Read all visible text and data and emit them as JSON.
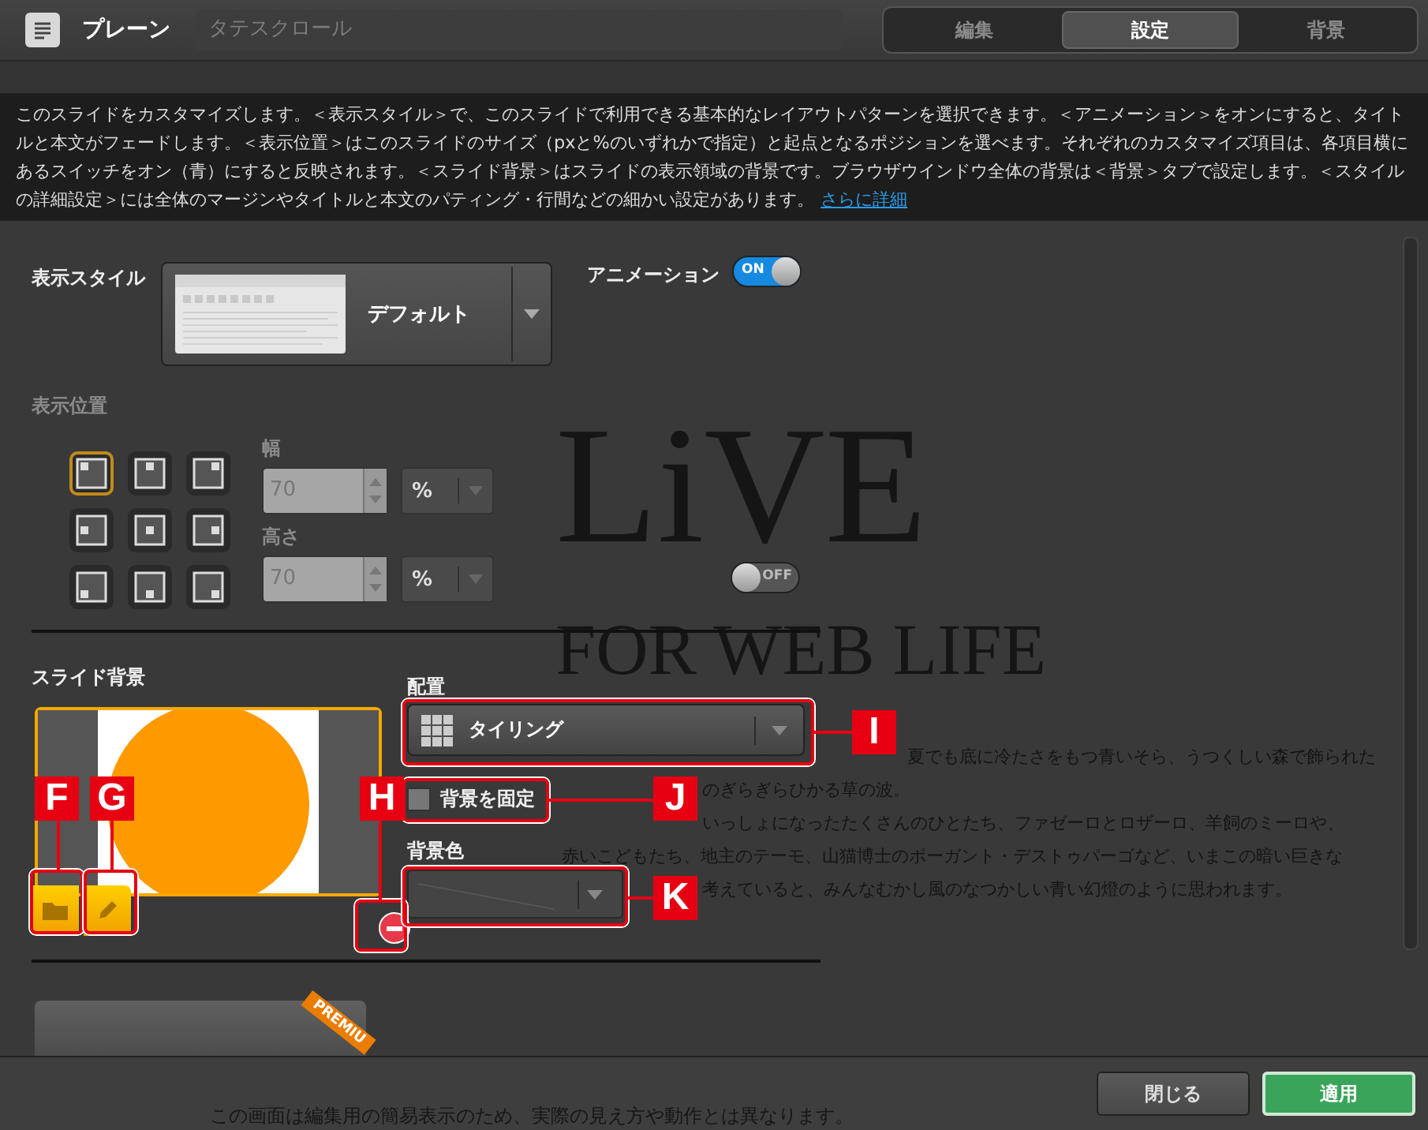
{
  "header": {
    "title": "プレーン",
    "scroll_field": "タテスクロール",
    "tabs": [
      {
        "label": "編集",
        "selected": false
      },
      {
        "label": "設定",
        "selected": true
      },
      {
        "label": "背景",
        "selected": false
      }
    ]
  },
  "description": {
    "text": "このスライドをカスタマイズします。＜表示スタイル＞で、このスライドで利用できる基本的なレイアウトパターンを選択できます。＜アニメーション＞をオンにすると、タイトルと本文がフェードします。＜表示位置＞はこのスライドのサイズ（pxと%のいずれかで指定）と起点となるポジションを選べます。それぞれのカスタマイズ項目は、各項目横にあるスイッチをオン（青）にすると反映されます。＜スライド背景＞はスライドの表示領域の背景です。ブラウザウインドウ全体の背景は＜背景＞タブで設定します。＜スタイルの詳細設定＞には全体のマージンやタイトルと本文のパティング・行間などの細かい設定があります。",
    "link": "さらに詳細"
  },
  "preview": {
    "logo": "LiVE",
    "tagline": "FOR WEB LIFE",
    "lines": [
      "夏でも底に冷たさをもつ青いそら、うつくしい森で飾られた",
      "のぎらぎらひかる草の波。",
      "いっしょになったたくさんのひとたち、ファゼーロとロザーロ、羊飼のミーロや、",
      "赤いこどもたち、地主のテーモ、山猫博士のボーガント・デストゥパーゴなど、いまこの暗い巨きな",
      "考えていると、みんなむかし風のなつかしい青い幻燈のように思われます。"
    ]
  },
  "display_style": {
    "label": "表示スタイル",
    "value": "デフォルト"
  },
  "animation": {
    "label": "アニメーション",
    "on": true,
    "toggle_text": "ON"
  },
  "position": {
    "label": "表示位置",
    "on": false,
    "toggle_text": "OFF",
    "cells": [
      {
        "selected": true
      },
      {
        "selected": false
      },
      {
        "selected": false
      },
      {
        "selected": false
      },
      {
        "selected": false
      },
      {
        "selected": false
      },
      {
        "selected": false
      },
      {
        "selected": false
      },
      {
        "selected": false
      }
    ],
    "width": {
      "label": "幅",
      "value": "70",
      "unit": "%"
    },
    "height": {
      "label": "高さ",
      "value": "70",
      "unit": "%"
    }
  },
  "slide_background": {
    "label": "スライド背景",
    "layout_label": "配置",
    "layout": "タイリング",
    "fixed": {
      "label": "背景を固定",
      "checked": false
    },
    "color_label": "背景色"
  },
  "premium_badge": "PREMIU",
  "callouts": [
    {
      "letter": "F"
    },
    {
      "letter": "G"
    },
    {
      "letter": "H"
    },
    {
      "letter": "I"
    },
    {
      "letter": "J"
    },
    {
      "letter": "K"
    }
  ],
  "footer": {
    "notice": "この画面は編集用の簡易表示のため、実際の見え方や動作とは異なります。",
    "buttons": [
      {
        "label": "閉じる",
        "kind": "secondary"
      },
      {
        "label": "適用",
        "kind": "primary"
      }
    ]
  }
}
